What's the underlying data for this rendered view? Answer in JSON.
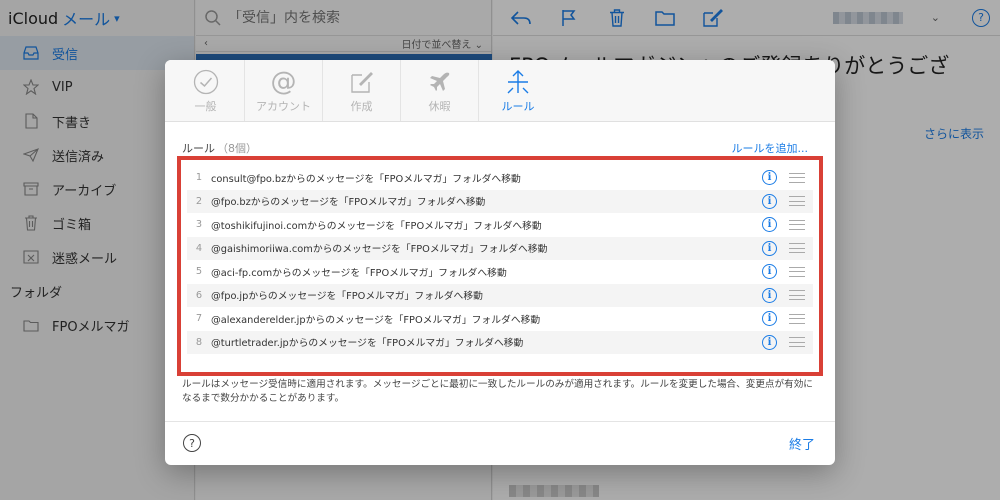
{
  "sidebar": {
    "brand": "iCloud",
    "app_name": "メール",
    "items": [
      {
        "label": "受信",
        "icon": "inbox-icon",
        "active": true
      },
      {
        "label": "VIP",
        "icon": "star-icon",
        "active": false
      },
      {
        "label": "下書き",
        "icon": "draft-document-icon",
        "active": false
      },
      {
        "label": "送信済み",
        "icon": "sent-paper-plane-icon",
        "active": false
      },
      {
        "label": "アーカイブ",
        "icon": "archive-box-icon",
        "active": false
      },
      {
        "label": "ゴミ箱",
        "icon": "trash-icon",
        "active": false
      },
      {
        "label": "迷惑メール",
        "icon": "junk-icon",
        "active": false
      }
    ],
    "folders_heading": "フォルダ",
    "folders": [
      {
        "label": "FPOメルマガ",
        "icon": "folder-icon"
      }
    ]
  },
  "mail_list": {
    "search_placeholder": "「受信」内を検索",
    "sort_label": "日付で並べ替え"
  },
  "reading_pane": {
    "subject": "FPOメールマガジンへのご登録ありがとうござ",
    "show_more": "さらに表示"
  },
  "modal": {
    "tabs": [
      {
        "label": "一般",
        "icon": "check-circle-icon",
        "active": false
      },
      {
        "label": "アカウント",
        "icon": "at-sign-icon",
        "active": false
      },
      {
        "label": "作成",
        "icon": "compose-icon",
        "active": false
      },
      {
        "label": "休暇",
        "icon": "airplane-icon",
        "active": false
      },
      {
        "label": "ルール",
        "icon": "rules-arrows-icon",
        "active": true
      }
    ],
    "rules_title": "ルール",
    "rules_count": "（8個）",
    "add_rule": "ルールを追加...",
    "rules": [
      {
        "num": "1",
        "text": "consult@fpo.bzからのメッセージを「FPOメルマガ」フォルダへ移動"
      },
      {
        "num": "2",
        "text": "@fpo.bzからのメッセージを「FPOメルマガ」フォルダへ移動"
      },
      {
        "num": "3",
        "text": "@toshikifujinoi.comからのメッセージを「FPOメルマガ」フォルダへ移動"
      },
      {
        "num": "4",
        "text": "@gaishimoriiwa.comからのメッセージを「FPOメルマガ」フォルダへ移動"
      },
      {
        "num": "5",
        "text": "@aci-fp.comからのメッセージを「FPOメルマガ」フォルダへ移動"
      },
      {
        "num": "6",
        "text": "@fpo.jpからのメッセージを「FPOメルマガ」フォルダへ移動"
      },
      {
        "num": "7",
        "text": "@alexanderelder.jpからのメッセージを「FPOメルマガ」フォルダへ移動"
      },
      {
        "num": "8",
        "text": "@turtletrader.jpからのメッセージを「FPOメルマガ」フォルダへ移動"
      }
    ],
    "note": "ルールはメッセージ受信時に適用されます。メッセージごとに最初に一致したルールのみが適用されます。ルールを変更した場合、変更点が有効になるまで数分かかることがあります。",
    "help_label": "?",
    "done_label": "終了"
  },
  "colors": {
    "accent": "#1a7ce6",
    "highlight_border": "#d94036"
  }
}
